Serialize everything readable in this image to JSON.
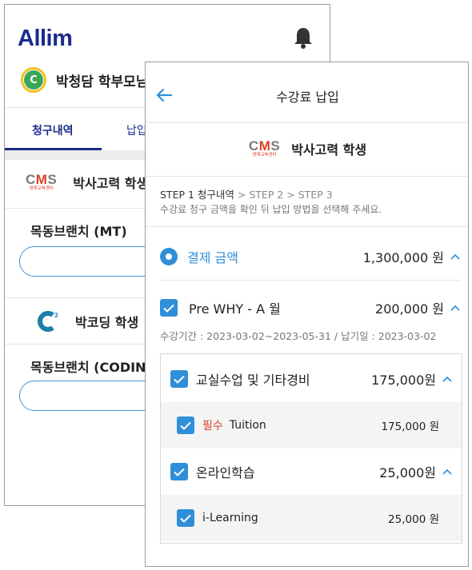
{
  "back_screen": {
    "logo": "Allim",
    "profile": {
      "avatar_letter": "C",
      "name": "박청담 학부모님"
    },
    "tabs": [
      "청구내역",
      "납입"
    ],
    "academies": [
      {
        "name": "박사고력 학생",
        "branch": "목동브랜치 (MT)"
      },
      {
        "name": "박코딩 학생",
        "branch": "목동브랜치 (CODING)"
      }
    ]
  },
  "front_screen": {
    "title": "수강료 납입",
    "student_name": "박사고력 학생",
    "cms_logo": {
      "c": "C",
      "m": "M",
      "s": "S",
      "sub": "영재교육센터"
    },
    "steps": {
      "current": "STEP 1 청구내역",
      "sep1": ">",
      "step2": "STEP 2",
      "sep2": ">",
      "step3": "STEP 3"
    },
    "step_description": "수강료 청구 금액을 확인 뒤 납입 방법을 선택해 주세요.",
    "payment": {
      "label": "결제 금액",
      "amount": "1,300,000 원"
    },
    "course": {
      "name": "Pre WHY - A 월",
      "amount": "200,000 원",
      "period": "수강기간 : 2023-03-02~2023-05-31 / 납기일 : 2023-03-02"
    },
    "groups": [
      {
        "name": "교실수업 및 기타경비",
        "amount": "175,000원",
        "item": {
          "required_label": "필수",
          "name": "Tuition",
          "amount": "175,000 원"
        }
      },
      {
        "name": "온라인학습",
        "amount": "25,000원",
        "item": {
          "required_label": "",
          "name": "i-Learning",
          "amount": "25,000 원"
        }
      }
    ]
  },
  "colors": {
    "brand_navy": "#1a2b8c",
    "accent_blue": "#2f8fd8",
    "required_red": "#d9402a"
  }
}
